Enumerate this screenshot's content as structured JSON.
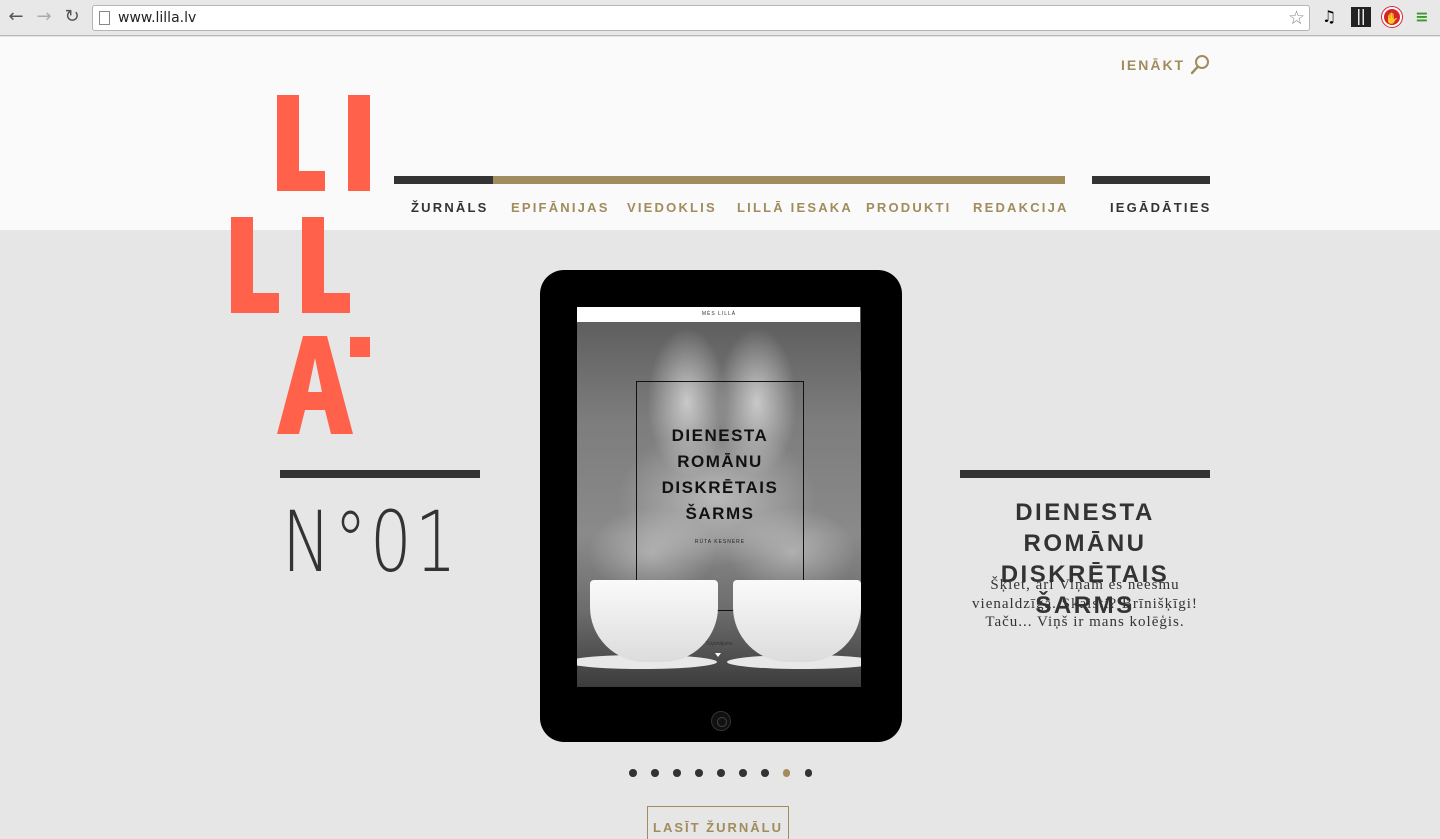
{
  "browser": {
    "url": "www.lilla.lv",
    "back_icon": "←",
    "forward_icon": "→",
    "reload_icon": "↻",
    "star_icon": "☆",
    "music_icon": "♫",
    "stop_icon": "✋",
    "menu_icon": "≡"
  },
  "header": {
    "login_label": "IENĀKT",
    "nav": [
      {
        "label": "ŽURNĀLS"
      },
      {
        "label": "EPIFĀNIJAS"
      },
      {
        "label": "VIEDOKLIS"
      },
      {
        "label": "LILLĀ IESAKA"
      },
      {
        "label": "PRODUKTI"
      },
      {
        "label": "REDAKCIJA"
      }
    ],
    "buy_label": "IEGĀDĀTIES"
  },
  "colors": {
    "brand": "#ff614a",
    "gold": "#a08c5c",
    "dark": "#333333"
  },
  "issue": {
    "number": "N°01"
  },
  "tablet": {
    "header_text": "MĒS LILLĀ",
    "cover_title_lines": [
      "DIENESTA",
      "ROMĀNU",
      "DISKRĒTAIS",
      "ŠARMS"
    ],
    "cover_author": "RŪTA KESNERE",
    "continue_text": "Turpinājums"
  },
  "teaser": {
    "title_line1": "DIENESTA ROMĀNU",
    "title_line2": "DISKRĒTAIS ŠARMS",
    "text_line1": "Šķiet, arī Viņam es neesmu",
    "text_line2": "vienaldzīga. Skaisti? Brīnišķīgi!",
    "text_line3": "Taču... Viņš ir mans kolēģis."
  },
  "carousel": {
    "slides": 9,
    "active_index": 7
  },
  "read_button_label": "LASĪT ŽURNĀLU"
}
